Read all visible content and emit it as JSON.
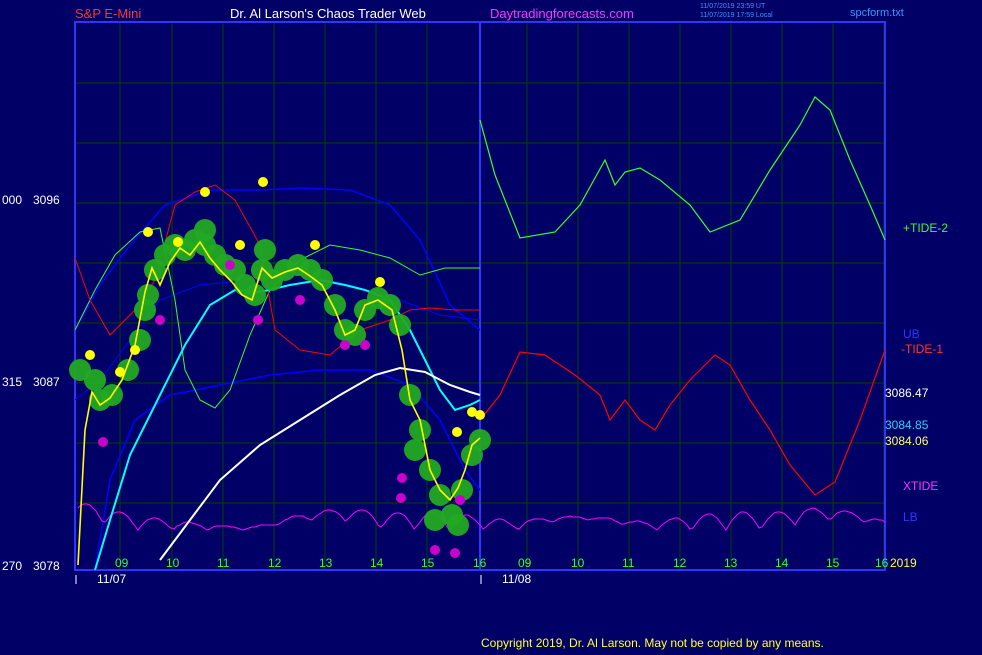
{
  "header": {
    "symbol": "S&P E-Mini",
    "title": "Dr. Al Larson's Chaos Trader Web",
    "site": "Daytradingforecasts.com",
    "timestamp_ut": "11/07/2019 23:59 UT",
    "timestamp_local": "11/07/2019 17:59 Local",
    "filename": "spcform.txt"
  },
  "footer": {
    "copyright": "Copyright 2019, Dr. Al Larson. May not be copied by any means."
  },
  "colors": {
    "background": "#000066",
    "grid": "#004400",
    "frame": "#3333ff",
    "price": "#ffff00",
    "tide_plus": "#33ff33",
    "tide_minus": "#ff0000",
    "xtide": "#ff00ff",
    "bands": "#0000ff",
    "fast_ma": "#00ffff",
    "slow_ma": "#ffffff"
  },
  "chart_data": {
    "type": "line",
    "title": "S&P E-Mini",
    "y_axis": {
      "ticks": [
        {
          "left": "000",
          "value": "3096"
        },
        {
          "left": "315",
          "value": "3087"
        },
        {
          "left": "270",
          "value": "3078"
        }
      ]
    },
    "x_axis": {
      "hour_ticks": [
        "09",
        "10",
        "11",
        "12",
        "13",
        "14",
        "15",
        "16",
        "09",
        "10",
        "11",
        "12",
        "13",
        "14",
        "15",
        "16"
      ],
      "date_labels": [
        "11/07",
        "11/08"
      ],
      "year_label": "2019"
    },
    "right_labels": {
      "tide_plus_2": "+TIDE-2",
      "ub": "UB",
      "tide_minus_1": "-TIDE-1",
      "price_1": "3086.47",
      "price_2": "3084.85",
      "price_3": "3084.06",
      "xtide": "XTIDE",
      "lb": "LB"
    },
    "series": [
      {
        "name": "+TIDE-2",
        "color": "#33ff33"
      },
      {
        "name": "-TIDE-1",
        "color": "#ff0000"
      },
      {
        "name": "XTIDE",
        "color": "#ff00ff"
      },
      {
        "name": "UB",
        "color": "#0000ff"
      },
      {
        "name": "LB",
        "color": "#0000ff"
      }
    ],
    "last_values": {
      "ub": "3086.47",
      "fast_ma": "3084.85",
      "price": "3084.06"
    }
  }
}
